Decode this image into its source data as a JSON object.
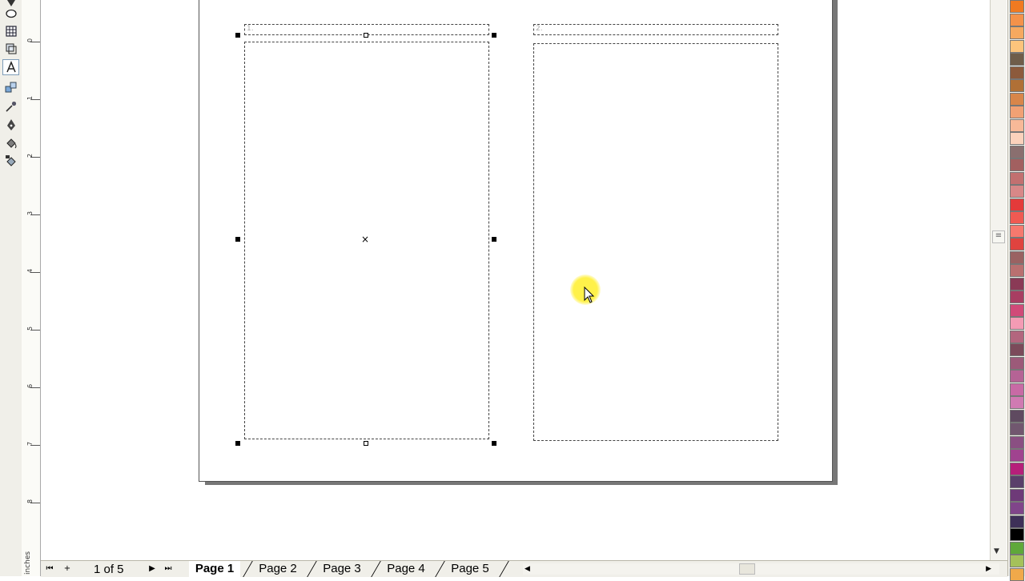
{
  "toolbox": {
    "tools": [
      {
        "icon": "pick-tool-icon",
        "active": false
      },
      {
        "icon": "ellipse-tool-icon",
        "active": false
      },
      {
        "icon": "table-tool-icon",
        "active": false
      },
      {
        "icon": "polygon-tool-icon",
        "active": false
      },
      {
        "icon": "text-tool-icon",
        "active": true
      },
      {
        "icon": "interactive-tool-icon",
        "active": false
      },
      {
        "icon": "eyedropper-tool-icon",
        "active": false
      },
      {
        "icon": "outline-pen-tool-icon",
        "active": false
      },
      {
        "icon": "fill-tool-icon",
        "active": false
      },
      {
        "icon": "interactive-fill-tool-icon",
        "active": false
      }
    ]
  },
  "ruler": {
    "units_label": "inches",
    "numbers": [
      "0",
      "1",
      "2",
      "3",
      "4",
      "5",
      "6",
      "7",
      "8"
    ]
  },
  "frames": [
    {
      "number": "1."
    },
    {
      "number": "2."
    }
  ],
  "pager": {
    "count": "1 of 5",
    "tabs": [
      "Page 1",
      "Page 2",
      "Page 3",
      "Page 4",
      "Page 5"
    ],
    "active_index": 0
  },
  "palette": {
    "colors": [
      "#f07a21",
      "#f4924a",
      "#f6a960",
      "#fcc47c",
      "#6f5d4a",
      "#8c5a3c",
      "#b07036",
      "#d8864a",
      "#f1a174",
      "#f8b998",
      "#fbd2bc",
      "#8a6f6f",
      "#a26060",
      "#c27070",
      "#d88888",
      "#e43a3a",
      "#ef5a52",
      "#f6796e",
      "#e0433f",
      "#9a6262",
      "#b97070",
      "#8a3a56",
      "#a83e62",
      "#d04a78",
      "#f49bb4",
      "#b3667e",
      "#7b4a5a",
      "#9c5a79",
      "#b56395",
      "#c86aa5",
      "#d07ab2",
      "#5f4a60",
      "#71576f",
      "#8a4f82",
      "#a0438f",
      "#b61f7a",
      "#5a3f6a",
      "#6e3a78",
      "#80458a",
      "#3e3058",
      "#000000",
      "#5fa83a",
      "#a5c15a",
      "#f0a94a"
    ]
  }
}
